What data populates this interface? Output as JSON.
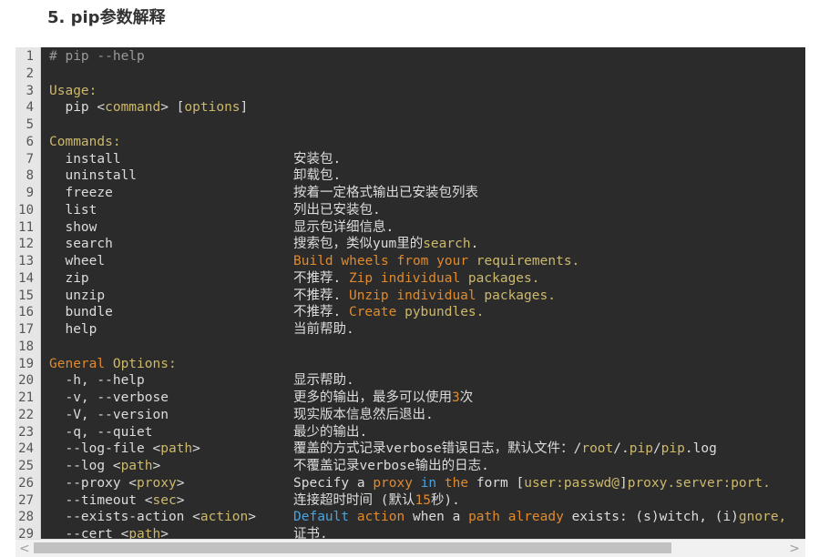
{
  "heading": "5. pip参数解释",
  "colors": {
    "background": "#2b2b2b",
    "text": "#dcdcdc",
    "comment": "#9a9a9a",
    "keyword": "#cdb96a",
    "string": "#e08a2e",
    "builtin": "#4aa3df",
    "gutter": "#e6e6e6"
  },
  "scrollbar": {
    "left_arrow": "<",
    "right_arrow": ">"
  },
  "lines": [
    {
      "n": "1",
      "code": [
        {
          "t": "# pip --help",
          "c": "comment"
        }
      ],
      "desc": []
    },
    {
      "n": "2",
      "code": [],
      "desc": []
    },
    {
      "n": "3",
      "code": [
        {
          "t": "Usage:",
          "c": "keyword"
        }
      ],
      "desc": []
    },
    {
      "n": "4",
      "code": [
        {
          "t": "  pip <",
          "c": "text"
        },
        {
          "t": "command",
          "c": "keyword"
        },
        {
          "t": "> [",
          "c": "text"
        },
        {
          "t": "options",
          "c": "keyword"
        },
        {
          "t": "]",
          "c": "text"
        }
      ],
      "desc": []
    },
    {
      "n": "5",
      "code": [],
      "desc": []
    },
    {
      "n": "6",
      "code": [
        {
          "t": "Commands:",
          "c": "keyword"
        }
      ],
      "desc": []
    },
    {
      "n": "7",
      "code": [
        {
          "t": "  install",
          "c": "text"
        }
      ],
      "desc": [
        {
          "t": "安装包.",
          "c": "text"
        }
      ]
    },
    {
      "n": "8",
      "code": [
        {
          "t": "  uninstall",
          "c": "text"
        }
      ],
      "desc": [
        {
          "t": "卸载包.",
          "c": "text"
        }
      ]
    },
    {
      "n": "9",
      "code": [
        {
          "t": "  freeze",
          "c": "text"
        }
      ],
      "desc": [
        {
          "t": "按着一定格式输出已安装包列表",
          "c": "text"
        }
      ]
    },
    {
      "n": "10",
      "code": [
        {
          "t": "  list",
          "c": "text"
        }
      ],
      "desc": [
        {
          "t": "列出已安装包.",
          "c": "text"
        }
      ]
    },
    {
      "n": "11",
      "code": [
        {
          "t": "  show",
          "c": "text"
        }
      ],
      "desc": [
        {
          "t": "显示包详细信息.",
          "c": "text"
        }
      ]
    },
    {
      "n": "12",
      "code": [
        {
          "t": "  search",
          "c": "text"
        }
      ],
      "desc": [
        {
          "t": "搜索包，类似yum里的",
          "c": "text"
        },
        {
          "t": "search",
          "c": "keyword"
        },
        {
          "t": ".",
          "c": "text"
        }
      ]
    },
    {
      "n": "13",
      "code": [
        {
          "t": "  wheel",
          "c": "text"
        }
      ],
      "desc": [
        {
          "t": "Build wheels from your",
          "c": "string"
        },
        {
          "t": " requirements.",
          "c": "keyword"
        }
      ]
    },
    {
      "n": "14",
      "code": [
        {
          "t": "  zip",
          "c": "text"
        }
      ],
      "desc": [
        {
          "t": "不推荐. ",
          "c": "text"
        },
        {
          "t": "Zip individual",
          "c": "string"
        },
        {
          "t": " packages.",
          "c": "keyword"
        }
      ]
    },
    {
      "n": "15",
      "code": [
        {
          "t": "  unzip",
          "c": "text"
        }
      ],
      "desc": [
        {
          "t": "不推荐. ",
          "c": "text"
        },
        {
          "t": "Unzip individual",
          "c": "string"
        },
        {
          "t": " packages.",
          "c": "keyword"
        }
      ]
    },
    {
      "n": "16",
      "code": [
        {
          "t": "  bundle",
          "c": "text"
        }
      ],
      "desc": [
        {
          "t": "不推荐. ",
          "c": "text"
        },
        {
          "t": "Create",
          "c": "string"
        },
        {
          "t": " pybundles.",
          "c": "keyword"
        }
      ]
    },
    {
      "n": "17",
      "code": [
        {
          "t": "  help",
          "c": "text"
        }
      ],
      "desc": [
        {
          "t": "当前帮助.",
          "c": "text"
        }
      ]
    },
    {
      "n": "18",
      "code": [],
      "desc": []
    },
    {
      "n": "19",
      "code": [
        {
          "t": "General",
          "c": "string"
        },
        {
          "t": " Options:",
          "c": "keyword"
        }
      ],
      "desc": []
    },
    {
      "n": "20",
      "code": [
        {
          "t": "  -h, --help",
          "c": "text"
        }
      ],
      "desc": [
        {
          "t": "显示帮助.",
          "c": "text"
        }
      ]
    },
    {
      "n": "21",
      "code": [
        {
          "t": "  -v, --verbose",
          "c": "text"
        }
      ],
      "desc": [
        {
          "t": "更多的输出，最多可以使用",
          "c": "text"
        },
        {
          "t": "3",
          "c": "string"
        },
        {
          "t": "次",
          "c": "text"
        }
      ]
    },
    {
      "n": "22",
      "code": [
        {
          "t": "  -V, --version",
          "c": "text"
        }
      ],
      "desc": [
        {
          "t": "现实版本信息然后退出.",
          "c": "text"
        }
      ]
    },
    {
      "n": "23",
      "code": [
        {
          "t": "  -q, --quiet",
          "c": "text"
        }
      ],
      "desc": [
        {
          "t": "最少的输出.",
          "c": "text"
        }
      ]
    },
    {
      "n": "24",
      "code": [
        {
          "t": "  --log-file <",
          "c": "text"
        },
        {
          "t": "path",
          "c": "keyword"
        },
        {
          "t": ">",
          "c": "text"
        }
      ],
      "desc": [
        {
          "t": "覆盖的方式记录verbose错误日志，默认文件：/",
          "c": "text"
        },
        {
          "t": "root",
          "c": "keyword"
        },
        {
          "t": "/.",
          "c": "text"
        },
        {
          "t": "pip",
          "c": "keyword"
        },
        {
          "t": "/",
          "c": "text"
        },
        {
          "t": "pip",
          "c": "keyword"
        },
        {
          "t": ".log",
          "c": "text"
        }
      ]
    },
    {
      "n": "25",
      "code": [
        {
          "t": "  --log <",
          "c": "text"
        },
        {
          "t": "path",
          "c": "keyword"
        },
        {
          "t": ">",
          "c": "text"
        }
      ],
      "desc": [
        {
          "t": "不覆盖记录verbose输出的日志.",
          "c": "text"
        }
      ]
    },
    {
      "n": "26",
      "code": [
        {
          "t": "  --proxy <",
          "c": "text"
        },
        {
          "t": "proxy",
          "c": "keyword"
        },
        {
          "t": ">",
          "c": "text"
        }
      ],
      "desc": [
        {
          "t": "Specify a ",
          "c": "text"
        },
        {
          "t": "proxy",
          "c": "string"
        },
        {
          "t": " ",
          "c": "text"
        },
        {
          "t": "in",
          "c": "builtin"
        },
        {
          "t": " ",
          "c": "text"
        },
        {
          "t": "the",
          "c": "string"
        },
        {
          "t": " form [",
          "c": "text"
        },
        {
          "t": "user:passwd@",
          "c": "keyword"
        },
        {
          "t": "]",
          "c": "text"
        },
        {
          "t": "proxy.server:port.",
          "c": "keyword"
        }
      ]
    },
    {
      "n": "27",
      "code": [
        {
          "t": "  --timeout <",
          "c": "text"
        },
        {
          "t": "sec",
          "c": "keyword"
        },
        {
          "t": ">",
          "c": "text"
        }
      ],
      "desc": [
        {
          "t": "连接超时时间 (默认",
          "c": "text"
        },
        {
          "t": "15",
          "c": "string"
        },
        {
          "t": "秒).",
          "c": "text"
        }
      ]
    },
    {
      "n": "28",
      "code": [
        {
          "t": "  --exists-action <",
          "c": "text"
        },
        {
          "t": "action",
          "c": "keyword"
        },
        {
          "t": ">",
          "c": "text"
        }
      ],
      "desc": [
        {
          "t": "Default",
          "c": "builtin"
        },
        {
          "t": " ",
          "c": "text"
        },
        {
          "t": "action",
          "c": "string"
        },
        {
          "t": " when a ",
          "c": "text"
        },
        {
          "t": "path",
          "c": "string"
        },
        {
          "t": " ",
          "c": "text"
        },
        {
          "t": "already",
          "c": "string"
        },
        {
          "t": " exists: (s)witch, (i)",
          "c": "text"
        },
        {
          "t": "gnore,",
          "c": "keyword"
        }
      ]
    },
    {
      "n": "29",
      "code": [
        {
          "t": "  --cert <",
          "c": "text"
        },
        {
          "t": "path",
          "c": "keyword"
        },
        {
          "t": ">",
          "c": "text"
        }
      ],
      "desc": [
        {
          "t": "证书.",
          "c": "text"
        }
      ]
    }
  ]
}
